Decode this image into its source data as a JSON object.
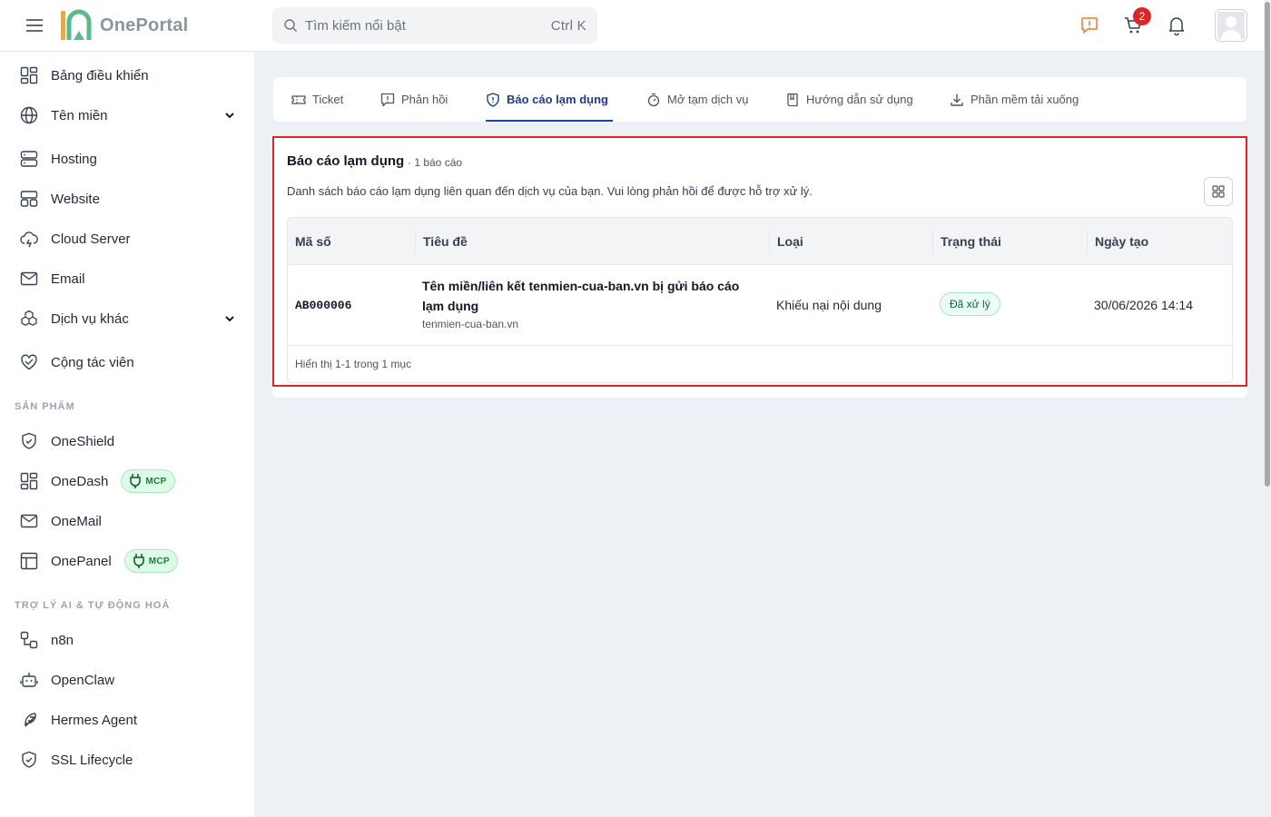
{
  "header": {
    "logo_text": "OnePortal",
    "search_placeholder": "Tìm kiếm nổi bật",
    "search_shortcut": "Ctrl K",
    "cart_count": "2"
  },
  "sidebar": {
    "items": [
      {
        "label": "Bảng điều khiển",
        "icon": "dashboard-icon"
      },
      {
        "label": "Tên miền",
        "icon": "globe-icon",
        "expandable": true
      },
      {
        "label": "Hosting",
        "icon": "server-icon"
      },
      {
        "label": "Website",
        "icon": "website-icon"
      },
      {
        "label": "Cloud Server",
        "icon": "cloud-icon"
      },
      {
        "label": "Email",
        "icon": "mail-icon"
      },
      {
        "label": "Dịch vụ khác",
        "icon": "boxes-icon",
        "expandable": true
      },
      {
        "label": "Cộng tác viên",
        "icon": "handshake-icon"
      }
    ],
    "section_products": "SẢN PHẨM",
    "products": [
      {
        "label": "OneShield",
        "icon": "shield-icon"
      },
      {
        "label": "OneDash",
        "icon": "dashboard-icon",
        "badge": "MCP"
      },
      {
        "label": "OneMail",
        "icon": "mail-icon"
      },
      {
        "label": "OnePanel",
        "icon": "panel-icon",
        "badge": "MCP"
      }
    ],
    "section_ai": "TRỢ LÝ AI & TỰ ĐỘNG HOÁ",
    "ai": [
      {
        "label": "n8n",
        "icon": "workflow-icon"
      },
      {
        "label": "OpenClaw",
        "icon": "bot-icon"
      },
      {
        "label": "Hermes Agent",
        "icon": "feather-icon"
      },
      {
        "label": "SSL Lifecycle",
        "icon": "shield-check-icon"
      }
    ]
  },
  "tabs": [
    {
      "label": "Ticket",
      "icon": "ticket-icon"
    },
    {
      "label": "Phản hồi",
      "icon": "message-alert-icon"
    },
    {
      "label": "Báo cáo lạm dụng",
      "icon": "shield-alert-icon",
      "active": true
    },
    {
      "label": "Mở tạm dịch vụ",
      "icon": "timer-icon"
    },
    {
      "label": "Hướng dẫn sử dụng",
      "icon": "book-icon"
    },
    {
      "label": "Phần mềm tải xuống",
      "icon": "download-icon"
    }
  ],
  "report": {
    "title": "Báo cáo lạm dụng",
    "count": "· 1 báo cáo",
    "description": "Danh sách báo cáo lạm dụng liên quan đến dịch vụ của bạn. Vui lòng phản hồi để được hỗ trợ xử lý.",
    "columns": [
      "Mã số",
      "Tiêu đề",
      "Loại",
      "Trạng thái",
      "Ngày tạo"
    ],
    "rows": [
      {
        "code": "AB000006",
        "title": "Tên miền/liên kết tenmien-cua-ban.vn bị gửi báo cáo lạm dụng",
        "subtitle": "tenmien-cua-ban.vn",
        "type": "Khiếu nại nội dung",
        "status": "Đã xử lý",
        "created": "30/06/2026 14:14"
      }
    ],
    "footer": "Hiển thị 1-1 trong 1 mục"
  },
  "colors": {
    "accent": "#1e40af",
    "highlight_border": "#dc2626",
    "status_green": "#065f46",
    "badge_red": "#dc2626"
  }
}
